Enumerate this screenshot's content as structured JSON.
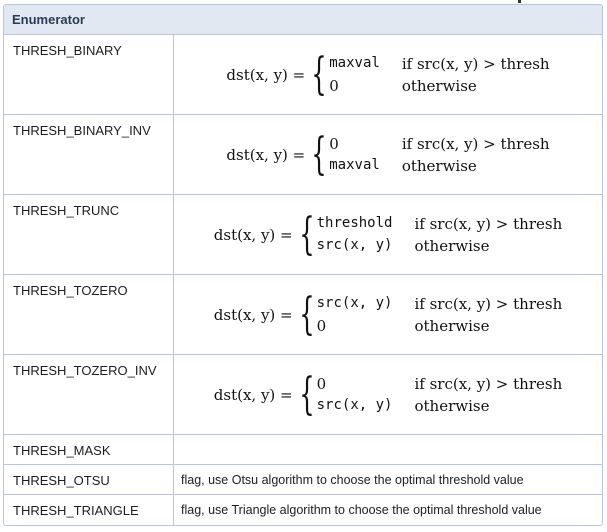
{
  "header": {
    "title": "Enumerator"
  },
  "rows": [
    {
      "name": "THRESH_BINARY",
      "lhs": "dst(x, y) =",
      "cases": [
        {
          "value": "maxval",
          "cond": "if src(x, y) > thresh"
        },
        {
          "value": "0",
          "cond": "otherwise"
        }
      ]
    },
    {
      "name": "THRESH_BINARY_INV",
      "lhs": "dst(x, y) =",
      "cases": [
        {
          "value": "0",
          "cond": "if src(x, y) > thresh"
        },
        {
          "value": "maxval",
          "cond": "otherwise"
        }
      ]
    },
    {
      "name": "THRESH_TRUNC",
      "lhs": "dst(x, y) =",
      "cases": [
        {
          "value": "threshold",
          "cond": "if src(x, y) > thresh"
        },
        {
          "value": "src(x, y)",
          "cond": "otherwise"
        }
      ]
    },
    {
      "name": "THRESH_TOZERO",
      "lhs": "dst(x, y) =",
      "cases": [
        {
          "value": "src(x, y)",
          "cond": "if src(x, y) > thresh"
        },
        {
          "value": "0",
          "cond": "otherwise"
        }
      ]
    },
    {
      "name": "THRESH_TOZERO_INV",
      "lhs": "dst(x, y) =",
      "cases": [
        {
          "value": "0",
          "cond": "if src(x, y) > thresh"
        },
        {
          "value": "src(x, y)",
          "cond": "otherwise"
        }
      ]
    },
    {
      "name": "THRESH_MASK",
      "text": ""
    },
    {
      "name": "THRESH_OTSU",
      "text": "flag, use Otsu algorithm to choose the optimal threshold value"
    },
    {
      "name": "THRESH_TRIANGLE",
      "text": "flag, use Triangle algorithm to choose the optimal threshold value"
    }
  ]
}
